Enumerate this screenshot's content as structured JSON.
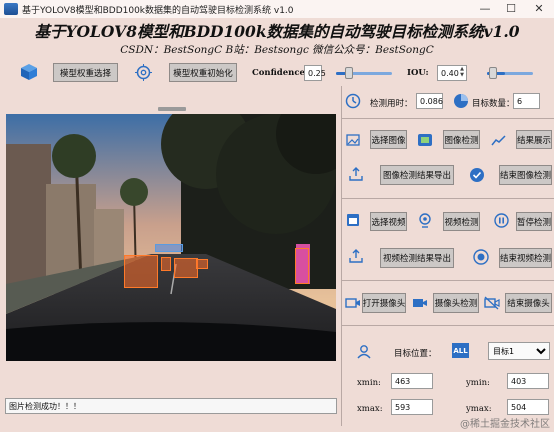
{
  "window": {
    "title": "基于YOLOV8模型和BDD100k数据集的自动驾驶目标检测系统 v1.0",
    "min_symbol": "—",
    "max_symbol": "☐",
    "close_symbol": "✕"
  },
  "header": {
    "title": "基于YOLOV8模型和BDD100k数据集的自动驾驶目标检测系统v1.0",
    "subtitle": "CSDN：BestSongC   B站：Bestsongc   微信公众号：BestSongC"
  },
  "toolbar": {
    "select_weights_label": "模型权重选择",
    "init_weights_label": "模型权重初始化",
    "confidence_label": "Confidence:",
    "confidence_value": "0.25",
    "confidence_level": 0.25,
    "iou_label": "IOU:",
    "iou_value": "0.40",
    "iou_level": 0.4
  },
  "stats": {
    "time_label": "检测用时：",
    "time_value": "0.086",
    "count_label": "目标数量：",
    "count_value": "6"
  },
  "image_panel": {
    "detections": 6
  },
  "image_section": {
    "select_label": "选择图像",
    "detect_label": "图像检测",
    "show_label": "结果展示",
    "export_label": "图像检测结果导出",
    "end_label": "结束图像检测"
  },
  "video_section": {
    "select_label": "选择视频",
    "detect_label": "视频检测",
    "pause_label": "暂停检测",
    "export_label": "视频检测结果导出",
    "end_label": "结束视频检测"
  },
  "camera_section": {
    "open_label": "打开摄像头",
    "detect_label": "摄像头检测",
    "end_label": "结束摄像头"
  },
  "target": {
    "position_label": "目标位置：",
    "all_badge": "ALL",
    "selected_target": "目标1",
    "xmin_label": "xmin:",
    "xmin_value": "463",
    "ymin_label": "ymin:",
    "ymin_value": "403",
    "xmax_label": "xmax:",
    "xmax_value": "593",
    "ymax_label": "ymax:",
    "ymax_value": "504"
  },
  "status": {
    "message": "图片检测成功！！！"
  },
  "watermark": "@稀土掘金技术社区",
  "colors": {
    "background": "#efdcd6",
    "accent_blue": "#2d6fc4",
    "detection_orange": "#ff7a2a"
  }
}
